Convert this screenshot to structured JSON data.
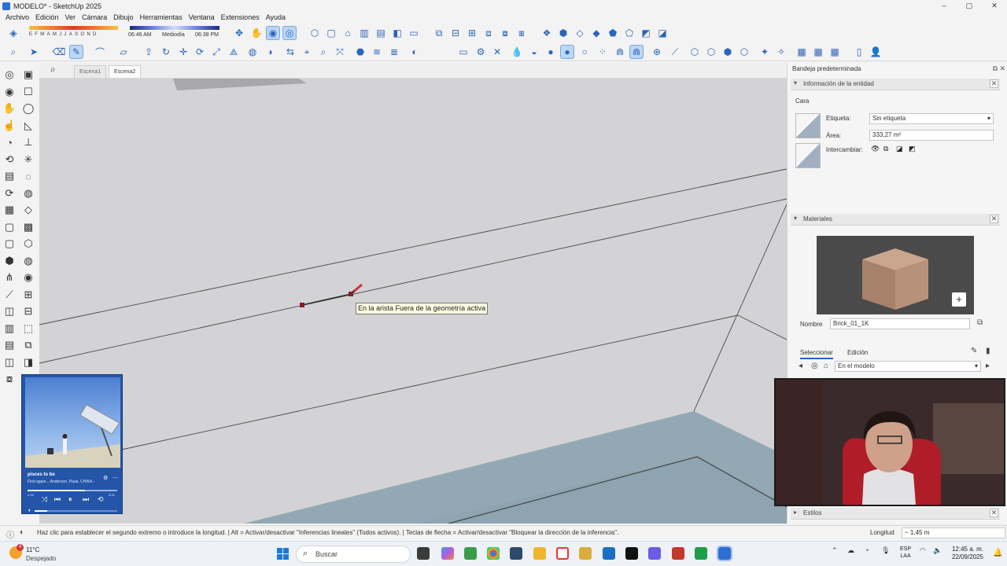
{
  "window": {
    "title": "MODELO* - SketchUp 2025",
    "controls": [
      "–",
      "▢",
      "✕"
    ]
  },
  "menu": [
    "Archivo",
    "Edición",
    "Ver",
    "Cámara",
    "Dibujo",
    "Herramientas",
    "Ventana",
    "Extensiones",
    "Ayuda"
  ],
  "shadows": {
    "months": "EFMAMJJASOND",
    "time_start": "06:46 AM",
    "time_mid": "Mediodía",
    "time_end": "06:38 PM"
  },
  "scenes": {
    "tabs": [
      "Escena1",
      "Escena2"
    ],
    "active": "Escena2"
  },
  "tooltip": "En la arista Fuera de la geometría activa",
  "tray": {
    "title": "Bandeja predeterminada",
    "entity_info": {
      "header": "Información de la entidad",
      "type": "Cara",
      "tag_label": "Etiqueta:",
      "tag_value": "Sin etiqueta",
      "area_label": "Área:",
      "area_value": "333,27 m²",
      "swap_label": "Intercambiar:"
    },
    "materials": {
      "header": "Materiales",
      "name_label": "Nombre",
      "name_value": "Brick_01_1K",
      "tab_select": "Seleccionar",
      "tab_edit": "Edición",
      "library": "En el modelo"
    },
    "styles": {
      "header": "Estilos"
    }
  },
  "media_player": {
    "title": "pisces to be",
    "artist": "Find again... Anderson .Paak, CHIKA -",
    "progress": 0.64,
    "time_elapsed": "2:15",
    "time_total": "3:32"
  },
  "status": {
    "message": "Haz clic para establecer el segundo extremo o introduce la longitud. | Alt = Activar/desactivar \"Inferencias lineales\" (Todos activos). | Teclas de flecha = Activar/desactivar \"Bloquear la dirección de la inferencia\".",
    "length_label": "Longitud",
    "length_value": "~ 1,45 m"
  },
  "taskbar": {
    "weather_temp": "11°C",
    "weather_desc": "Despejado",
    "weather_badge": "4",
    "search_placeholder": "Buscar",
    "lang_top": "ESP",
    "lang_bottom": "LAA",
    "time": "12:45 a. m.",
    "date": "22/09/2025"
  },
  "colors": {
    "viewport_bg": "#d3d3d5",
    "floor_face": "#93a8b3",
    "tray_bg": "#f5f5f5",
    "tooltip_bg": "#ffffe1",
    "accent": "#2b64b8",
    "draw_endpoint": "#8b1a2a"
  }
}
